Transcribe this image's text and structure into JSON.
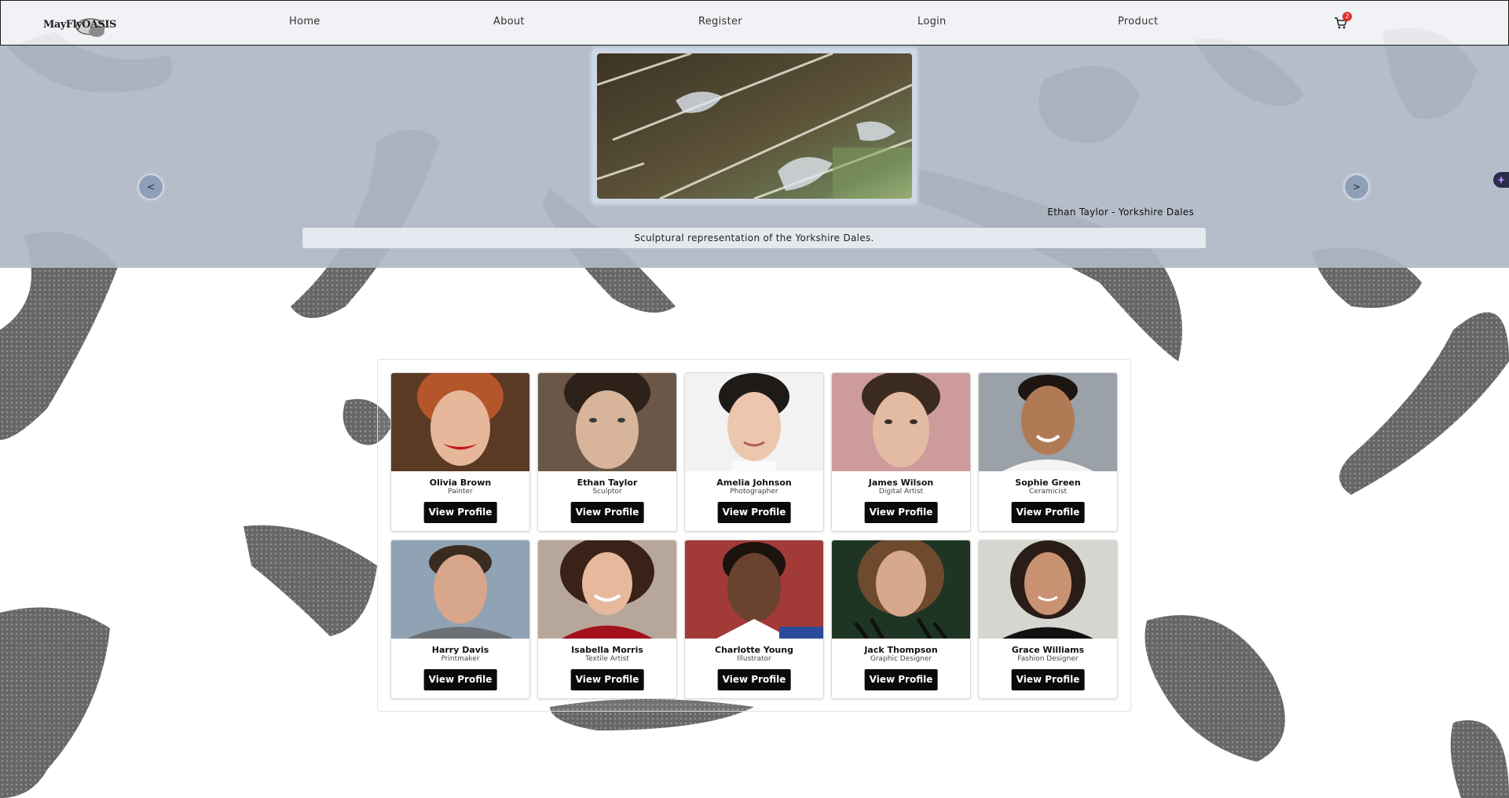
{
  "nav": {
    "logo_text": "MayFlyOASIS",
    "links": [
      "Home",
      "About",
      "Register",
      "Login",
      "Product"
    ],
    "cart_icon": "shopping-cart-icon",
    "cart_count": "2"
  },
  "hero": {
    "prev_label": "<",
    "next_label": ">",
    "credit": "Ethan Taylor - Yorkshire Dales",
    "caption": "Sculptural representation of the Yorkshire Dales."
  },
  "artists": [
    {
      "name": "Olivia Brown",
      "role": "Painter",
      "button": "View Profile"
    },
    {
      "name": "Ethan Taylor",
      "role": "Sculptor",
      "button": "View Profile"
    },
    {
      "name": "Amelia Johnson",
      "role": "Photographer",
      "button": "View Profile"
    },
    {
      "name": "James Wilson",
      "role": "Digital Artist",
      "button": "View Profile"
    },
    {
      "name": "Sophie Green",
      "role": "Ceramicist",
      "button": "View Profile"
    },
    {
      "name": "Harry Davis",
      "role": "Printmaker",
      "button": "View Profile"
    },
    {
      "name": "Isabella Morris",
      "role": "Textile Artist",
      "button": "View Profile"
    },
    {
      "name": "Charlotte Young",
      "role": "Illustrator",
      "button": "View Profile"
    },
    {
      "name": "Jack Thompson",
      "role": "Graphic Designer",
      "button": "View Profile"
    },
    {
      "name": "Grace Williams",
      "role": "Fashion Designer",
      "button": "View Profile"
    }
  ],
  "colors": {
    "hero_bg": "#afb8c6",
    "nav_bg": "#f0f1f4",
    "button_bg": "#0a0a0a",
    "badge": "#e0312b"
  }
}
